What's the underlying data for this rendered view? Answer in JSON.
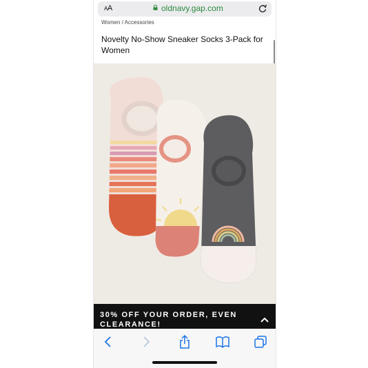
{
  "browser": {
    "text_size_label_small": "A",
    "text_size_label_large": "A",
    "url": "oldnavy.gap.com"
  },
  "breadcrumb": "Women / Accessories",
  "product": {
    "title": "Novelty No-Show Sneaker Socks 3-Pack for Women"
  },
  "promo": {
    "text": "30% OFF YOUR ORDER, EVEN CLEARANCE!"
  },
  "toolbar": {
    "icons": [
      "back-icon",
      "forward-icon",
      "share-icon",
      "bookmarks-icon",
      "tabs-icon"
    ]
  },
  "colors": {
    "url_green": "#2b8a3e",
    "promo_bg": "#111111",
    "product_bg": "#eeebe4"
  }
}
